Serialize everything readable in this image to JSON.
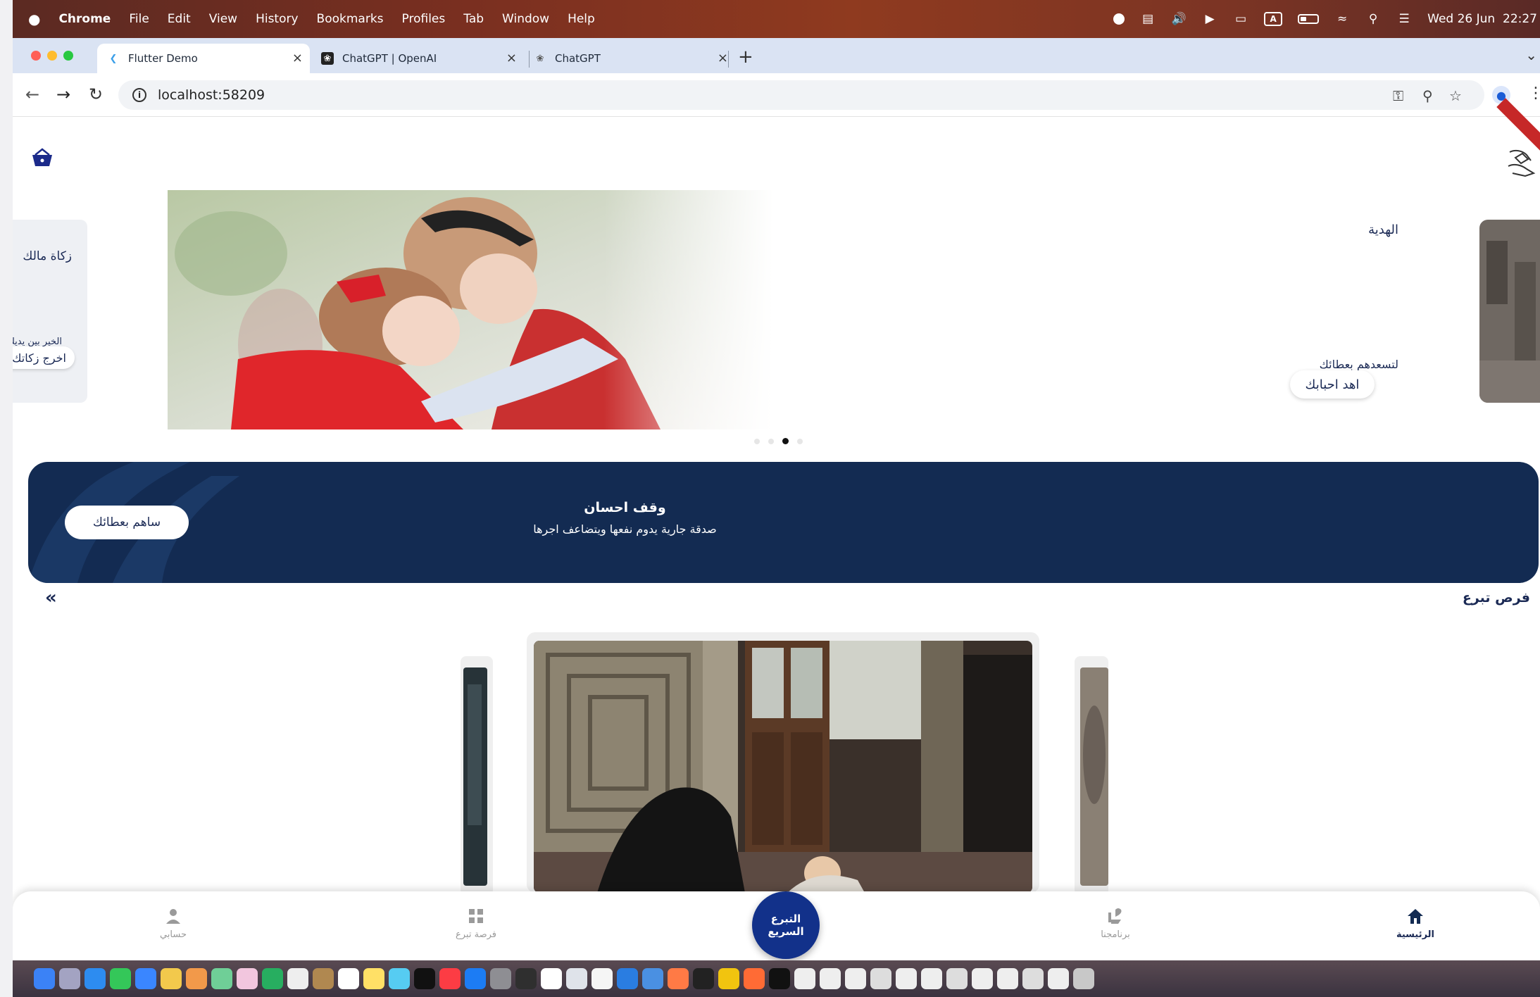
{
  "menubar": {
    "apple": "",
    "app": "Chrome",
    "items": [
      "File",
      "Edit",
      "View",
      "History",
      "Bookmarks",
      "Profiles",
      "Tab",
      "Window",
      "Help"
    ],
    "clock": "Wed 26 Jun  22:27",
    "status_icons": [
      "record-icon",
      "pasta-icon",
      "volume-icon",
      "play-icon",
      "display-icon",
      "input-source-icon",
      "battery-icon",
      "wifi-icon",
      "search-icon",
      "control-center-icon"
    ],
    "input_source": "A"
  },
  "tabs": [
    {
      "title": "Flutter Demo",
      "icon": "flutter-icon",
      "active": true
    },
    {
      "title": "ChatGPT | OpenAI",
      "icon": "openai-icon",
      "active": false
    },
    {
      "title": "ChatGPT",
      "icon": "chatgpt-icon",
      "active": false
    }
  ],
  "tab_close": "×",
  "new_tab": "+",
  "address": {
    "url": "localhost:58209",
    "info": "i"
  },
  "page": {
    "promo_left": {
      "title": "زكاة مالك",
      "subtitle": "الخير بين يديك",
      "button": "اخرج زكاتك"
    },
    "hero": {
      "title": "الهدية",
      "subtitle": "لتسعدهم بعطائك",
      "button": "اهد احبابك"
    },
    "carousel_dots": 4,
    "carousel_active": 2,
    "waqf": {
      "title": "وقف احسان",
      "subtitle": "صدقة جارية يدوم نفعها ويتضاعف اجرها",
      "button": "ساهم بعطائك"
    },
    "section": {
      "title": "فرص تبرع",
      "more": "«"
    }
  },
  "bottom_nav": {
    "items": [
      {
        "label": "حسابي",
        "icon": "person-icon"
      },
      {
        "label": "فرصة تبرع",
        "icon": "grid-icon"
      },
      {
        "label": "برنامجنا",
        "icon": "hand-heart-icon"
      },
      {
        "label": "الرئيسية",
        "icon": "home-icon"
      }
    ],
    "fab": "التبرع السريع",
    "active": "الرئيسية"
  },
  "colors": {
    "primary": "#132b52",
    "accent": "#12318a",
    "text": "#1b2a55"
  }
}
